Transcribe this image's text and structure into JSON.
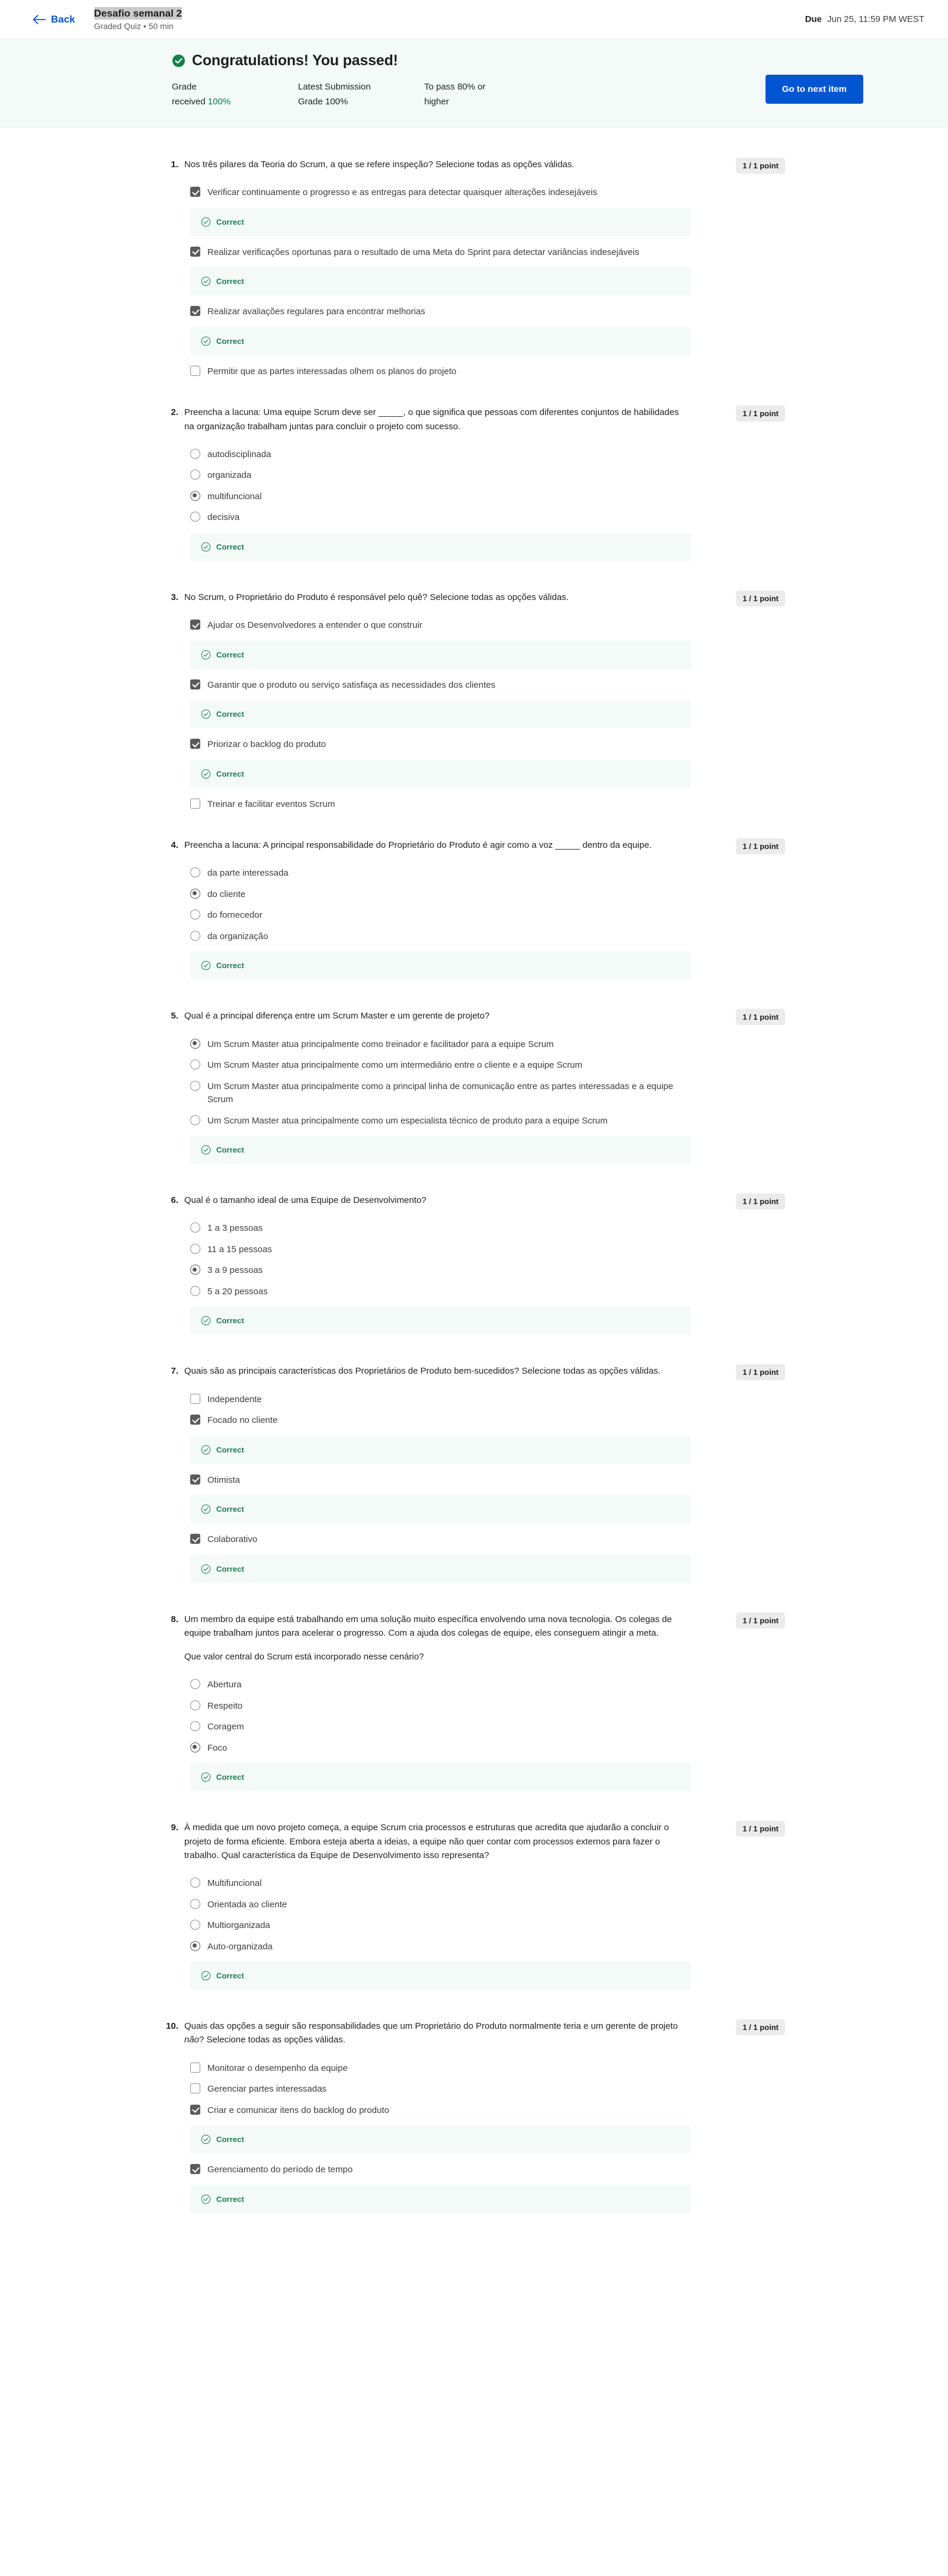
{
  "header": {
    "back_label": "Back",
    "quiz_title": "Desafio semanal 2",
    "quiz_subtitle": "Graded Quiz • 50 min",
    "due_label": "Due",
    "due_value": "Jun 25, 11:59 PM WEST"
  },
  "banner": {
    "title": "Congratulations! You passed!",
    "stats": [
      {
        "line1": "Grade",
        "line2_prefix": "received ",
        "line2_value": "100%",
        "highlight": true
      },
      {
        "line1": "Latest Submission",
        "line2_prefix": "Grade ",
        "line2_value": "100%",
        "highlight": false
      },
      {
        "line1": "To pass 80% or",
        "line2_prefix": "higher",
        "line2_value": "",
        "highlight": false
      }
    ],
    "next_button": "Go to next item"
  },
  "feedback_label": "Correct",
  "points_label": "1 / 1 point",
  "questions": [
    {
      "number": "1.",
      "points": "1 / 1 point",
      "paragraphs": [
        "Nos três pilares da Teoria do Scrum, a que se refere inspeção? Selecione todas as opções válidas."
      ],
      "type": "checkbox",
      "options": [
        {
          "label": "Verificar continuamente o progresso e as entregas para detectar quaisquer alterações indesejáveis",
          "selected": true,
          "feedback": "Correct"
        },
        {
          "label": "Realizar verificações oportunas para o resultado de uma Meta do Sprint para detectar variâncias indesejáveis",
          "selected": true,
          "feedback": "Correct"
        },
        {
          "label": "Realizar avaliações regulares para encontrar melhorias",
          "selected": true,
          "feedback": "Correct"
        },
        {
          "label": "Permitir que as partes interessadas olhem os planos do projeto",
          "selected": false,
          "feedback": ""
        }
      ]
    },
    {
      "number": "2.",
      "points": "1 / 1 point",
      "paragraphs": [
        "Preencha a lacuna: Uma equipe Scrum deve ser _____, o que significa que pessoas com diferentes conjuntos de habilidades na organização trabalham juntas para concluir o projeto com sucesso."
      ],
      "type": "radio",
      "options": [
        {
          "label": "autodisciplinada",
          "selected": false,
          "feedback": ""
        },
        {
          "label": "organizada",
          "selected": false,
          "feedback": ""
        },
        {
          "label": "multifuncional",
          "selected": true,
          "feedback": ""
        },
        {
          "label": "decisiva",
          "selected": false,
          "feedback": ""
        }
      ],
      "group_feedback": "Correct"
    },
    {
      "number": "3.",
      "points": "1 / 1 point",
      "paragraphs": [
        "No Scrum, o Proprietário do Produto é responsável pelo quê? Selecione todas as opções válidas."
      ],
      "type": "checkbox",
      "options": [
        {
          "label": "Ajudar os Desenvolvedores a entender o que construir",
          "selected": true,
          "feedback": "Correct"
        },
        {
          "label": "Garantir que o produto ou serviço satisfaça as necessidades dos clientes",
          "selected": true,
          "feedback": "Correct"
        },
        {
          "label": "Priorizar o backlog do produto",
          "selected": true,
          "feedback": "Correct"
        },
        {
          "label": "Treinar e facilitar eventos Scrum",
          "selected": false,
          "feedback": ""
        }
      ]
    },
    {
      "number": "4.",
      "points": "1 / 1 point",
      "paragraphs": [
        "Preencha a lacuna: A principal responsabilidade do Proprietário do Produto é agir como a voz _____ dentro da equipe."
      ],
      "type": "radio",
      "options": [
        {
          "label": "da parte interessada",
          "selected": false,
          "feedback": ""
        },
        {
          "label": "do cliente",
          "selected": true,
          "feedback": ""
        },
        {
          "label": "do fornecedor",
          "selected": false,
          "feedback": ""
        },
        {
          "label": "da organização",
          "selected": false,
          "feedback": ""
        }
      ],
      "group_feedback": "Correct"
    },
    {
      "number": "5.",
      "points": "1 / 1 point",
      "paragraphs": [
        "Qual é a principal diferença entre um Scrum Master e um gerente de projeto?"
      ],
      "type": "radio",
      "options": [
        {
          "label": "Um Scrum Master atua principalmente como treinador e facilitador para a equipe Scrum",
          "selected": true,
          "feedback": ""
        },
        {
          "label": "Um Scrum Master atua principalmente como um intermediário entre o cliente e a equipe Scrum",
          "selected": false,
          "feedback": ""
        },
        {
          "label": "Um Scrum Master atua principalmente como a principal linha de comunicação entre as partes interessadas e a equipe Scrum",
          "selected": false,
          "feedback": ""
        },
        {
          "label": "Um Scrum Master atua principalmente como um especialista técnico de produto para a equipe Scrum",
          "selected": false,
          "feedback": ""
        }
      ],
      "group_feedback": "Correct"
    },
    {
      "number": "6.",
      "points": "1 / 1 point",
      "paragraphs": [
        "Qual é o tamanho ideal de uma Equipe de Desenvolvimento?"
      ],
      "type": "radio",
      "options": [
        {
          "label": "1 a 3 pessoas",
          "selected": false,
          "feedback": ""
        },
        {
          "label": "11 a 15 pessoas",
          "selected": false,
          "feedback": ""
        },
        {
          "label": "3 a 9 pessoas",
          "selected": true,
          "feedback": ""
        },
        {
          "label": "5 a 20 pessoas",
          "selected": false,
          "feedback": ""
        }
      ],
      "group_feedback": "Correct"
    },
    {
      "number": "7.",
      "points": "1 / 1 point",
      "paragraphs": [
        "Quais são as principais características dos Proprietários de Produto bem-sucedidos? Selecione todas as opções válidas."
      ],
      "type": "checkbox",
      "options": [
        {
          "label": "Independente",
          "selected": false,
          "feedback": ""
        },
        {
          "label": "Focado no cliente",
          "selected": true,
          "feedback": "Correct"
        },
        {
          "label": "Otimista",
          "selected": true,
          "feedback": "Correct"
        },
        {
          "label": "Colaborativo",
          "selected": true,
          "feedback": "Correct"
        }
      ]
    },
    {
      "number": "8.",
      "points": "1 / 1 point",
      "paragraphs": [
        "Um membro da equipe está trabalhando em uma solução muito específica envolvendo uma nova tecnologia. Os colegas de equipe trabalham juntos para acelerar o progresso. Com a ajuda dos colegas de equipe, eles conseguem atingir a meta.",
        "Que valor central do Scrum está incorporado nesse cenário?"
      ],
      "type": "radio",
      "options": [
        {
          "label": "Abertura",
          "selected": false,
          "feedback": ""
        },
        {
          "label": "Respeito",
          "selected": false,
          "feedback": ""
        },
        {
          "label": "Coragem",
          "selected": false,
          "feedback": ""
        },
        {
          "label": "Foco",
          "selected": true,
          "feedback": ""
        }
      ],
      "group_feedback": "Correct"
    },
    {
      "number": "9.",
      "points": "1 / 1 point",
      "paragraphs": [
        "À medida que um novo projeto começa, a equipe Scrum cria processos e estruturas que acredita que ajudarão a concluir o projeto de forma eficiente. Embora esteja aberta a ideias, a equipe não quer contar com processos externos para fazer o trabalho. Qual característica da Equipe de Desenvolvimento isso representa?"
      ],
      "type": "radio",
      "options": [
        {
          "label": "Multifuncional",
          "selected": false,
          "feedback": ""
        },
        {
          "label": "Orientada ao cliente",
          "selected": false,
          "feedback": ""
        },
        {
          "label": "Multiorganizada",
          "selected": false,
          "feedback": ""
        },
        {
          "label": "Auto-organizada",
          "selected": true,
          "feedback": ""
        }
      ],
      "group_feedback": "Correct"
    },
    {
      "number": "10.",
      "points": "1 / 1 point",
      "paragraphs": [
        "Quais das opções a seguir são responsabilidades que um Proprietário do Produto normalmente teria e um gerente de projeto <em>não</em>? Selecione todas as opções válidas."
      ],
      "type": "checkbox",
      "options": [
        {
          "label": "Monitorar o desempenho da equipe",
          "selected": false,
          "feedback": ""
        },
        {
          "label": "Gerenciar partes interessadas",
          "selected": false,
          "feedback": ""
        },
        {
          "label": "Criar e comunicar itens do backlog do produto",
          "selected": true,
          "feedback": "Correct"
        },
        {
          "label": "Gerenciamento do período de tempo",
          "selected": true,
          "feedback": "Correct"
        }
      ]
    }
  ]
}
